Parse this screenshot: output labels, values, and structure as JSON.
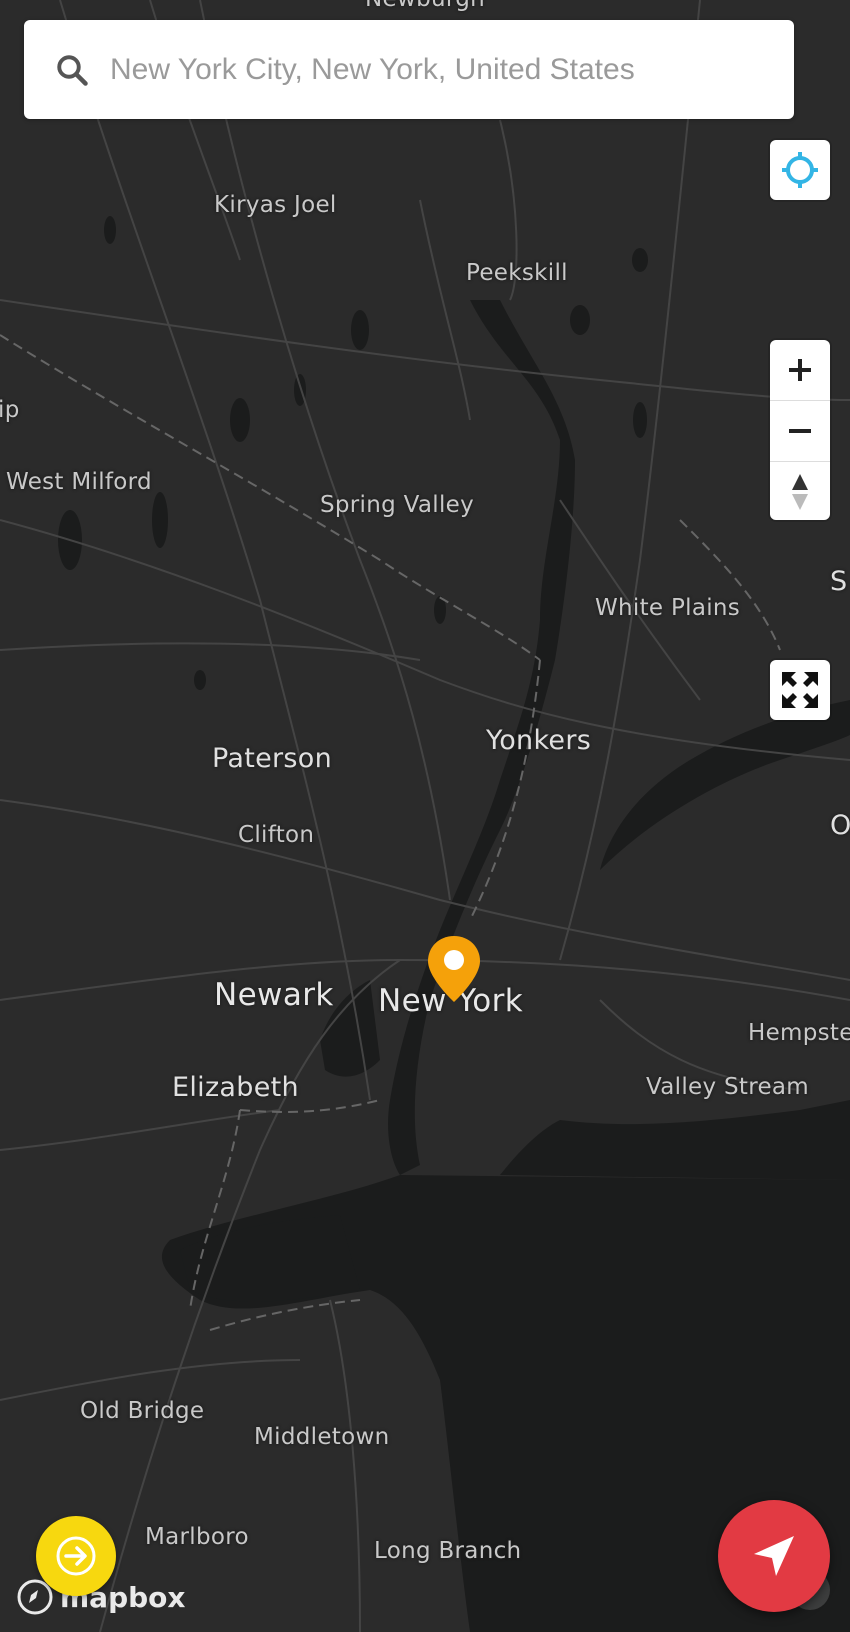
{
  "search": {
    "placeholder": "New York City, New York, United States"
  },
  "map": {
    "places": [
      {
        "label": "Newburgh",
        "size": "small"
      },
      {
        "label": "Kiryas Joel",
        "size": "small"
      },
      {
        "label": "Peekskill",
        "size": "small"
      },
      {
        "label": "West Milford",
        "size": "small"
      },
      {
        "label": "Spring Valley",
        "size": "small"
      },
      {
        "label": "White Plains",
        "size": "small"
      },
      {
        "label": "Paterson",
        "size": "medium"
      },
      {
        "label": "Yonkers",
        "size": "medium"
      },
      {
        "label": "Clifton",
        "size": "small"
      },
      {
        "label": "Newark",
        "size": "large"
      },
      {
        "label": "New York",
        "size": "large"
      },
      {
        "label": "Hempste",
        "size": "small"
      },
      {
        "label": "Elizabeth",
        "size": "medium"
      },
      {
        "label": "Valley Stream",
        "size": "small"
      },
      {
        "label": "Old Bridge",
        "size": "small"
      },
      {
        "label": "Middletown",
        "size": "small"
      },
      {
        "label": "Marlboro",
        "size": "small"
      },
      {
        "label": "Long Branch",
        "size": "small"
      },
      {
        "label": "ip",
        "size": "small"
      },
      {
        "label": "S",
        "size": "medium"
      },
      {
        "label": "O",
        "size": "medium"
      }
    ],
    "marker": {
      "label": "",
      "color": "#f5a10a"
    },
    "colors": {
      "land": "#2b2b2b",
      "water": "#1b1c1c",
      "roads": "#3f3f3f"
    }
  },
  "controls": {
    "locate_icon": "locate-crosshair-icon",
    "zoom_in_icon": "plus-icon",
    "zoom_out_icon": "minus-icon",
    "compass_icon": "compass-icon",
    "fullscreen_icon": "fullscreen-icon"
  },
  "buttons": {
    "yellow_fab": {
      "icon": "arrow-right-circle-icon",
      "color": "#f7d80f"
    },
    "red_fab": {
      "icon": "navigation-arrow-icon",
      "color": "#e23a43"
    }
  },
  "attribution": {
    "logo_text": "mapbox"
  }
}
